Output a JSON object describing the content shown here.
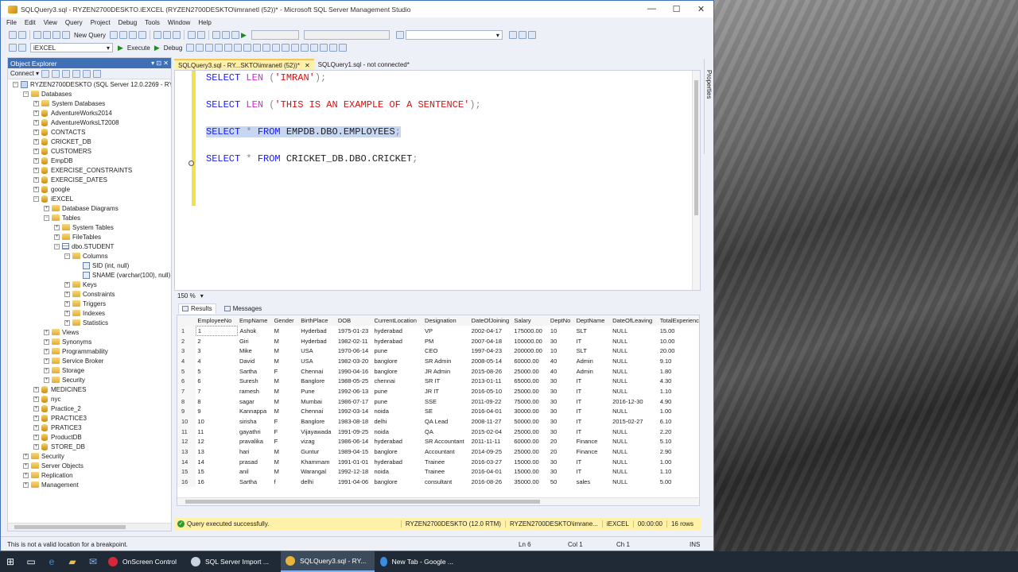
{
  "window": {
    "title": "SQLQuery3.sql - RYZEN2700DESKTO.iEXCEL (RYZEN2700DESKTO\\imranetl (52))* - Microsoft SQL Server Management Studio",
    "minimize": "—",
    "maximize": "☐",
    "close": "✕"
  },
  "menu": [
    "File",
    "Edit",
    "View",
    "Query",
    "Project",
    "Debug",
    "Tools",
    "Window",
    "Help"
  ],
  "toolbar": {
    "new_query": "New Query",
    "database": "iEXCEL",
    "execute": "Execute",
    "debug": "Debug"
  },
  "object_explorer": {
    "title": "Object Explorer",
    "pins": "▾ ⊡ ✕",
    "connect": "Connect ▾",
    "nodes": [
      {
        "label": "RYZEN2700DESKTO (SQL Server 12.0.2269 - RYZEN",
        "level": 0,
        "toggle": "−",
        "icon": "srv"
      },
      {
        "label": "Databases",
        "level": 1,
        "toggle": "−",
        "icon": "folder"
      },
      {
        "label": "System Databases",
        "level": 2,
        "toggle": "+",
        "icon": "folder"
      },
      {
        "label": "AdventureWorks2014",
        "level": 2,
        "toggle": "+",
        "icon": "db"
      },
      {
        "label": "AdventureWorksLT2008",
        "level": 2,
        "toggle": "+",
        "icon": "db"
      },
      {
        "label": "CONTACTS",
        "level": 2,
        "toggle": "+",
        "icon": "db"
      },
      {
        "label": "CRICKET_DB",
        "level": 2,
        "toggle": "+",
        "icon": "db"
      },
      {
        "label": "CUSTOMERS",
        "level": 2,
        "toggle": "+",
        "icon": "db"
      },
      {
        "label": "EmpDB",
        "level": 2,
        "toggle": "+",
        "icon": "db"
      },
      {
        "label": "EXERCISE_CONSTRAINTS",
        "level": 2,
        "toggle": "+",
        "icon": "db"
      },
      {
        "label": "EXERCISE_DATES",
        "level": 2,
        "toggle": "+",
        "icon": "db"
      },
      {
        "label": "google",
        "level": 2,
        "toggle": "+",
        "icon": "db"
      },
      {
        "label": "iEXCEL",
        "level": 2,
        "toggle": "−",
        "icon": "db"
      },
      {
        "label": "Database Diagrams",
        "level": 3,
        "toggle": "+",
        "icon": "folder"
      },
      {
        "label": "Tables",
        "level": 3,
        "toggle": "−",
        "icon": "folder"
      },
      {
        "label": "System Tables",
        "level": 4,
        "toggle": "+",
        "icon": "folder"
      },
      {
        "label": "FileTables",
        "level": 4,
        "toggle": "+",
        "icon": "folder"
      },
      {
        "label": "dbo.STUDENT",
        "level": 4,
        "toggle": "−",
        "icon": "table"
      },
      {
        "label": "Columns",
        "level": 5,
        "toggle": "−",
        "icon": "folder"
      },
      {
        "label": "SID (int, null)",
        "level": 6,
        "toggle": "",
        "icon": "col"
      },
      {
        "label": "SNAME (varchar(100), null)",
        "level": 6,
        "toggle": "",
        "icon": "col"
      },
      {
        "label": "Keys",
        "level": 5,
        "toggle": "+",
        "icon": "folder"
      },
      {
        "label": "Constraints",
        "level": 5,
        "toggle": "+",
        "icon": "folder"
      },
      {
        "label": "Triggers",
        "level": 5,
        "toggle": "+",
        "icon": "folder"
      },
      {
        "label": "Indexes",
        "level": 5,
        "toggle": "+",
        "icon": "folder"
      },
      {
        "label": "Statistics",
        "level": 5,
        "toggle": "+",
        "icon": "folder"
      },
      {
        "label": "Views",
        "level": 3,
        "toggle": "+",
        "icon": "folder"
      },
      {
        "label": "Synonyms",
        "level": 3,
        "toggle": "+",
        "icon": "folder"
      },
      {
        "label": "Programmability",
        "level": 3,
        "toggle": "+",
        "icon": "folder"
      },
      {
        "label": "Service Broker",
        "level": 3,
        "toggle": "+",
        "icon": "folder"
      },
      {
        "label": "Storage",
        "level": 3,
        "toggle": "+",
        "icon": "folder"
      },
      {
        "label": "Security",
        "level": 3,
        "toggle": "+",
        "icon": "folder"
      },
      {
        "label": "MEDICINES",
        "level": 2,
        "toggle": "+",
        "icon": "db"
      },
      {
        "label": "nyc",
        "level": 2,
        "toggle": "+",
        "icon": "db"
      },
      {
        "label": "Practice_2",
        "level": 2,
        "toggle": "+",
        "icon": "db"
      },
      {
        "label": "PRACTICE3",
        "level": 2,
        "toggle": "+",
        "icon": "db"
      },
      {
        "label": "PRATICE3",
        "level": 2,
        "toggle": "+",
        "icon": "db"
      },
      {
        "label": "ProductDB",
        "level": 2,
        "toggle": "+",
        "icon": "db"
      },
      {
        "label": "STORE_DB",
        "level": 2,
        "toggle": "+",
        "icon": "db"
      },
      {
        "label": "Security",
        "level": 1,
        "toggle": "+",
        "icon": "folder"
      },
      {
        "label": "Server Objects",
        "level": 1,
        "toggle": "+",
        "icon": "folder"
      },
      {
        "label": "Replication",
        "level": 1,
        "toggle": "+",
        "icon": "folder"
      },
      {
        "label": "Management",
        "level": 1,
        "toggle": "+",
        "icon": "folder"
      }
    ]
  },
  "tabs": [
    {
      "label": "SQLQuery3.sql - RY...SKTO\\imranetl (52))*",
      "close": "✕",
      "active": true
    },
    {
      "label": "SQLQuery1.sql - not connected*",
      "active": false
    }
  ],
  "editor": {
    "lines": [
      {
        "parts": [
          {
            "t": "SELECT ",
            "c": "kw"
          },
          {
            "t": "LEN ",
            "c": "fn"
          },
          {
            "t": "(",
            "c": "op"
          },
          {
            "t": "'IMRAN'",
            "c": "str"
          },
          {
            "t": ");",
            "c": "op"
          }
        ]
      },
      {
        "parts": [
          {
            "t": "SELECT ",
            "c": "kw"
          },
          {
            "t": "LEN ",
            "c": "fn"
          },
          {
            "t": "(",
            "c": "op"
          },
          {
            "t": "'THIS IS AN EXAMPLE OF A SENTENCE'",
            "c": "str"
          },
          {
            "t": ");",
            "c": "op"
          }
        ]
      },
      {
        "parts": [
          {
            "t": "SELECT ",
            "c": "kw"
          },
          {
            "t": "* ",
            "c": "op"
          },
          {
            "t": "FROM ",
            "c": "kw"
          },
          {
            "t": "EMPDB.DBO.EMPLOYEES",
            "c": ""
          },
          {
            "t": ";",
            "c": "op"
          }
        ],
        "selected": true
      },
      {
        "parts": [
          {
            "t": "SELECT ",
            "c": "kw"
          },
          {
            "t": "* ",
            "c": "op"
          },
          {
            "t": "FROM ",
            "c": "kw"
          },
          {
            "t": "CRICKET_DB.DBO.CRICKET",
            "c": ""
          },
          {
            "t": ";",
            "c": "op"
          }
        ]
      }
    ]
  },
  "zoom": "150 %",
  "results": {
    "tabs": [
      "Results",
      "Messages"
    ],
    "columns": [
      "",
      "EmployeeNo",
      "EmpName",
      "Gender",
      "BirthPlace",
      "DOB",
      "CurrentLocation",
      "Designation",
      "DateOfJoining",
      "Salary",
      "DeptNo",
      "DeptName",
      "DateOfLeaving",
      "TotalExperienc"
    ],
    "rows": [
      [
        "1",
        "1",
        "Ashok",
        "M",
        "Hyderbad",
        "1975-01-23",
        "hyderabad",
        "VP",
        "2002-04-17",
        "175000.00",
        "10",
        "SLT",
        "NULL",
        "15.00"
      ],
      [
        "2",
        "2",
        "Giri",
        "M",
        "Hyderbad",
        "1982-02-11",
        "hyderabad",
        "PM",
        "2007-04-18",
        "100000.00",
        "30",
        "IT",
        "NULL",
        "10.00"
      ],
      [
        "3",
        "3",
        "Mike",
        "M",
        "USA",
        "1970-06-14",
        "pune",
        "CEO",
        "1997-04-23",
        "200000.00",
        "10",
        "SLT",
        "NULL",
        "20.00"
      ],
      [
        "4",
        "4",
        "David",
        "M",
        "USA",
        "1982-03-20",
        "banglore",
        "SR Admin",
        "2008-05-14",
        "60000.00",
        "40",
        "Admin",
        "NULL",
        "9.10"
      ],
      [
        "5",
        "5",
        "Sartha",
        "F",
        "Chennai",
        "1990-04-16",
        "banglore",
        "JR Admin",
        "2015-08-26",
        "25000.00",
        "40",
        "Admin",
        "NULL",
        "1.80"
      ],
      [
        "6",
        "6",
        "Suresh",
        "M",
        "Banglore",
        "1988-05-25",
        "chennai",
        "SR IT",
        "2013-01-11",
        "65000.00",
        "30",
        "IT",
        "NULL",
        "4.30"
      ],
      [
        "7",
        "7",
        "ramesh",
        "M",
        "Pune",
        "1992-06-13",
        "pune",
        "JR IT",
        "2016-05-10",
        "25000.00",
        "30",
        "IT",
        "NULL",
        "1.10"
      ],
      [
        "8",
        "8",
        "sagar",
        "M",
        "Mumbai",
        "1986-07-17",
        "pune",
        "SSE",
        "2011-09-22",
        "75000.00",
        "30",
        "IT",
        "2016-12-30",
        "4.90"
      ],
      [
        "9",
        "9",
        "Kannappa",
        "M",
        "Chennai",
        "1992-03-14",
        "noida",
        "SE",
        "2016-04-01",
        "30000.00",
        "30",
        "IT",
        "NULL",
        "1.00"
      ],
      [
        "10",
        "10",
        "sirisha",
        "F",
        "Banglore",
        "1983-08-18",
        "delhi",
        "QA Lead",
        "2008-11-27",
        "50000.00",
        "30",
        "IT",
        "2015-02-27",
        "6.10"
      ],
      [
        "11",
        "11",
        "gayathri",
        "F",
        "Vijayawada",
        "1991-09-25",
        "noida",
        "QA",
        "2015-02-04",
        "25000.00",
        "30",
        "IT",
        "NULL",
        "2.20"
      ],
      [
        "12",
        "12",
        "pravalika",
        "F",
        "vizag",
        "1986-06-14",
        "hyderabad",
        "SR Accountant",
        "2011-11-11",
        "60000.00",
        "20",
        "Finance",
        "NULL",
        "5.10"
      ],
      [
        "13",
        "13",
        "hari",
        "M",
        "Guntur",
        "1989-04-15",
        "banglore",
        "Accountant",
        "2014-09-25",
        "25000.00",
        "20",
        "Finance",
        "NULL",
        "2.90"
      ],
      [
        "14",
        "14",
        "prasad",
        "M",
        "Khammam",
        "1991-01-01",
        "hyderabad",
        "Trainee",
        "2016-03-27",
        "15000.00",
        "30",
        "IT",
        "NULL",
        "1.00"
      ],
      [
        "15",
        "15",
        "anil",
        "M",
        "Warangal",
        "1992-12-18",
        "noida",
        "Trainee",
        "2016-04-01",
        "15000.00",
        "30",
        "IT",
        "NULL",
        "1.10"
      ],
      [
        "16",
        "16",
        "Sartha",
        "f",
        "delhi",
        "1991-04-06",
        "banglore",
        "consultant",
        "2016-08-26",
        "35000.00",
        "50",
        "sales",
        "NULL",
        "5.00"
      ]
    ]
  },
  "query_status": {
    "message": "Query executed successfully.",
    "server": "RYZEN2700DESKTO (12.0 RTM)",
    "login": "RYZEN2700DESKTO\\imrane...",
    "database": "iEXCEL",
    "elapsed": "00:00:00",
    "rows": "16 rows"
  },
  "properties_label": "Properties",
  "statusbar": {
    "message": "This is not a valid location for a breakpoint.",
    "ln": "Ln 6",
    "col": "Col 1",
    "ch": "Ch 1",
    "ins": "INS"
  },
  "taskbar": {
    "apps": [
      {
        "label": "OnScreen Control",
        "color": "#d7283a",
        "active": false
      },
      {
        "label": "SQL Server Import ...",
        "color": "#c9d2de",
        "active": false
      },
      {
        "label": "SQLQuery3.sql - RY...",
        "color": "#e9b43a",
        "active": true
      },
      {
        "label": "New Tab - Google ...",
        "color": "#3b8de0",
        "active": false
      }
    ]
  },
  "colors": {
    "accent": "#3f6fb5",
    "tab_active": "#fff0a8",
    "status_bar": "#fff1a8",
    "keyword": "#1a1aff",
    "function": "#d02bd0",
    "string": "#d11313"
  }
}
